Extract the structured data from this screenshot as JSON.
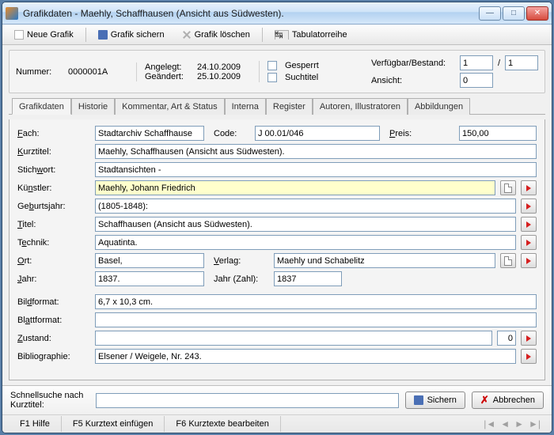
{
  "window": {
    "title": "Grafikdaten  -  Maehly, Schaffhausen (Ansicht aus Südwesten)."
  },
  "toolbar": {
    "neue": "Neue Grafik",
    "sichern": "Grafik sichern",
    "loeschen": "Grafik löschen",
    "tabreihe": "Tabulatorreihe"
  },
  "header": {
    "nummer_lbl": "Nummer:",
    "nummer_val": "0000001A",
    "angelegt_lbl": "Angelegt:",
    "angelegt_val": "24.10.2009",
    "geaendert_lbl": "Geändert:",
    "geaendert_val": "25.10.2009",
    "gesperrt": "Gesperrt",
    "suchtitel": "Suchtitel",
    "verfuegbar_lbl": "Verfügbar/Bestand:",
    "verfuegbar_a": "1",
    "verfuegbar_b": "1",
    "ansicht_lbl": "Ansicht:",
    "ansicht_val": "0",
    "slash": "/"
  },
  "tabs": [
    "Grafikdaten",
    "Historie",
    "Kommentar, Art & Status",
    "Interna",
    "Register",
    "Autoren, Illustratoren",
    "Abbildungen"
  ],
  "form": {
    "fach": {
      "lbl": "Fach:",
      "val": "Stadtarchiv Schaffhause"
    },
    "code": {
      "lbl": "Code:",
      "val": "J 00.01/046"
    },
    "preis": {
      "lbl": "Preis:",
      "val": "150,00"
    },
    "kurztitel": {
      "lbl": "Kurztitel:",
      "val": "Maehly, Schaffhausen (Ansicht aus Südwesten)."
    },
    "stichwort": {
      "lbl": "Stichwort:",
      "val": "Stadtansichten -"
    },
    "kuenstler": {
      "lbl": "Künstler:",
      "val": "Maehly, Johann Friedrich"
    },
    "geburtsjahr": {
      "lbl": "Geburtsjahr:",
      "val": "(1805-1848):"
    },
    "titel": {
      "lbl": "Titel:",
      "val": "Schaffhausen (Ansicht aus Südwesten)."
    },
    "technik": {
      "lbl": "Technik:",
      "val": "Aquatinta."
    },
    "ort": {
      "lbl": "Ort:",
      "val": "Basel,"
    },
    "verlag": {
      "lbl": "Verlag:",
      "val": "Maehly und Schabelitz"
    },
    "jahr": {
      "lbl": "Jahr:",
      "val": "1837."
    },
    "jahrzahl": {
      "lbl": "Jahr (Zahl):",
      "val": "1837"
    },
    "bildformat": {
      "lbl": "Bildformat:",
      "val": "6,7 x 10,3 cm."
    },
    "blattformat": {
      "lbl": "Blattformat:",
      "val": ""
    },
    "zustand": {
      "lbl": "Zustand:",
      "val": "",
      "num": "0"
    },
    "bibliographie": {
      "lbl": "Bibliographie:",
      "val": "Elsener / Weigele, Nr. 243."
    }
  },
  "footer": {
    "schnell_lbl": "Schnellsuche nach Kurztitel:",
    "sichern_btn": "Sichern",
    "abbrechen_btn": "Abbrechen",
    "f1": "F1 Hilfe",
    "f5": "F5 Kurztext einfügen",
    "f6": "F6 Kurztexte bearbeiten"
  }
}
